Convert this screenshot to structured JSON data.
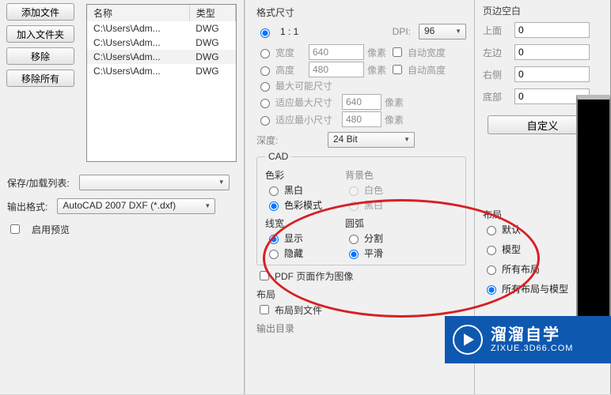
{
  "left": {
    "buttons": {
      "add_file": "添加文件",
      "add_folder": "加入文件夹",
      "remove": "移除",
      "remove_all": "移除所有"
    },
    "table": {
      "headers": {
        "name": "名称",
        "type": "类型"
      },
      "rows": [
        {
          "name": "C:\\Users\\Adm...",
          "type": "DWG"
        },
        {
          "name": "C:\\Users\\Adm...",
          "type": "DWG"
        },
        {
          "name": "C:\\Users\\Adm...",
          "type": "DWG"
        },
        {
          "name": "C:\\Users\\Adm...",
          "type": "DWG"
        }
      ]
    },
    "save_load_label": "保存/加载列表:",
    "output_format_label": "输出格式:",
    "output_format_value": "AutoCAD 2007 DXF (*.dxf)",
    "enable_preview": "启用预览"
  },
  "mid": {
    "format_size": "格式尺寸",
    "ratio_11": "1 : 1",
    "dpi_label": "DPI:",
    "dpi_value": "96",
    "width_label": "宽度",
    "width_value": "640",
    "px": "像素",
    "auto_width": "自动宽度",
    "height_label": "高度",
    "height_value": "480",
    "auto_height": "自动高度",
    "max_possible": "最大可能尺寸",
    "fit_max": "适应最大尺寸",
    "fit_max_value": "640",
    "fit_min": "适应最小尺寸",
    "fit_min_value": "480",
    "depth_label": "深度:",
    "depth_value": "24 Bit",
    "cad": "CAD",
    "color": "色彩",
    "bw": "黑白",
    "color_mode": "色彩模式",
    "bg": "背景色",
    "white": "白色",
    "black": "黑白",
    "layout": "布局",
    "default": "默认",
    "model": "模型",
    "all_layouts": "所有布局",
    "all_layouts_model": "所有布局与模型",
    "linewidth": "线宽",
    "show": "显示",
    "hide": "隐藏",
    "arc": "圆弧",
    "split": "分割",
    "smooth": "平滑",
    "pdf_as_image": "PDF 页面作为图像",
    "layout2": "布局",
    "layout_to_file": "布局到文件",
    "output_dir": "输出目录"
  },
  "right": {
    "margin": "页边空白",
    "top": "上面",
    "top_v": "0",
    "left": "左边",
    "left_v": "0",
    "right": "右侧",
    "right_v": "0",
    "bottom": "底部",
    "bottom_v": "0",
    "custom": "自定义"
  },
  "logo": {
    "main": "溜溜自学",
    "sub": "ZIXUE.3D66.COM"
  }
}
